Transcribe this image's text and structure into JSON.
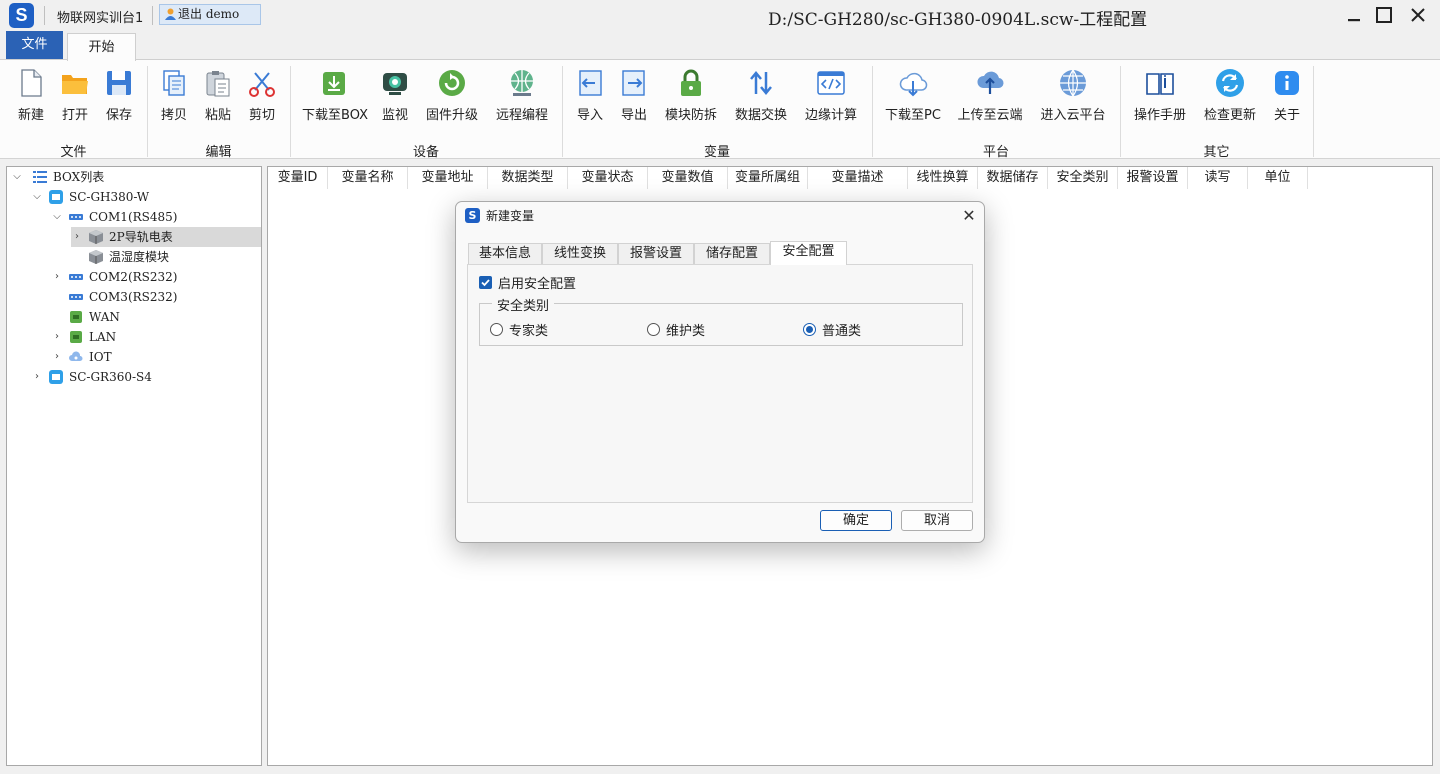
{
  "titlebar": {
    "quick_title": "物联网实训台1",
    "logout_label": "退出 demo",
    "window_title": "D:/SC-GH280/sc-GH380-0904L.scw-工程配置"
  },
  "ribbon_tabs": {
    "file": "文件",
    "start": "开始"
  },
  "ribbon": {
    "buttons": {
      "new": "新建",
      "open": "打开",
      "save": "保存",
      "copy": "拷贝",
      "paste": "粘贴",
      "cut": "剪切",
      "download_box": "下载至BOX",
      "monitor": "监视",
      "firmware": "固件升级",
      "remote": "远程编程",
      "import": "导入",
      "export": "导出",
      "module_protect": "模块防拆",
      "data_exchange": "数据交换",
      "edge_compute": "边缘计算",
      "download_pc": "下载至PC",
      "upload_cloud": "上传至云端",
      "enter_cloud": "进入云平台",
      "manual": "操作手册",
      "check_update": "检查更新",
      "about": "关于"
    },
    "groups": {
      "file": "文件",
      "edit": "编辑",
      "device": "设备",
      "variable": "变量",
      "platform": "平台",
      "other": "其它"
    }
  },
  "tree": {
    "root": "BOX列表",
    "gh380": "SC-GH380-W",
    "com1": "COM1(RS485)",
    "meter": "2P导轨电表",
    "temp": "温湿度模块",
    "com2": "COM2(RS232)",
    "com3": "COM3(RS232)",
    "wan": "WAN",
    "lan": "LAN",
    "iot": "IOT",
    "gr360": "SC-GR360-S4"
  },
  "grid": {
    "columns": [
      "变量ID",
      "变量名称",
      "变量地址",
      "数据类型",
      "变量状态",
      "变量数值",
      "变量所属组",
      "变量描述",
      "线性换算",
      "数据储存",
      "安全类别",
      "报警设置",
      "读写",
      "单位"
    ]
  },
  "dialog": {
    "title": "新建变量",
    "tabs": [
      "基本信息",
      "线性变换",
      "报警设置",
      "储存配置",
      "安全配置"
    ],
    "active_tab": "安全配置",
    "enable_label": "启用安全配置",
    "enable_checked": true,
    "group_title": "安全类别",
    "options": [
      "专家类",
      "维护类",
      "普通类"
    ],
    "selected_option": "普通类",
    "ok": "确定",
    "cancel": "取消"
  },
  "colors": {
    "accent": "#1a5fb4",
    "file_tab": "#2b62b5",
    "tree_selected": "#d9d9d9"
  }
}
